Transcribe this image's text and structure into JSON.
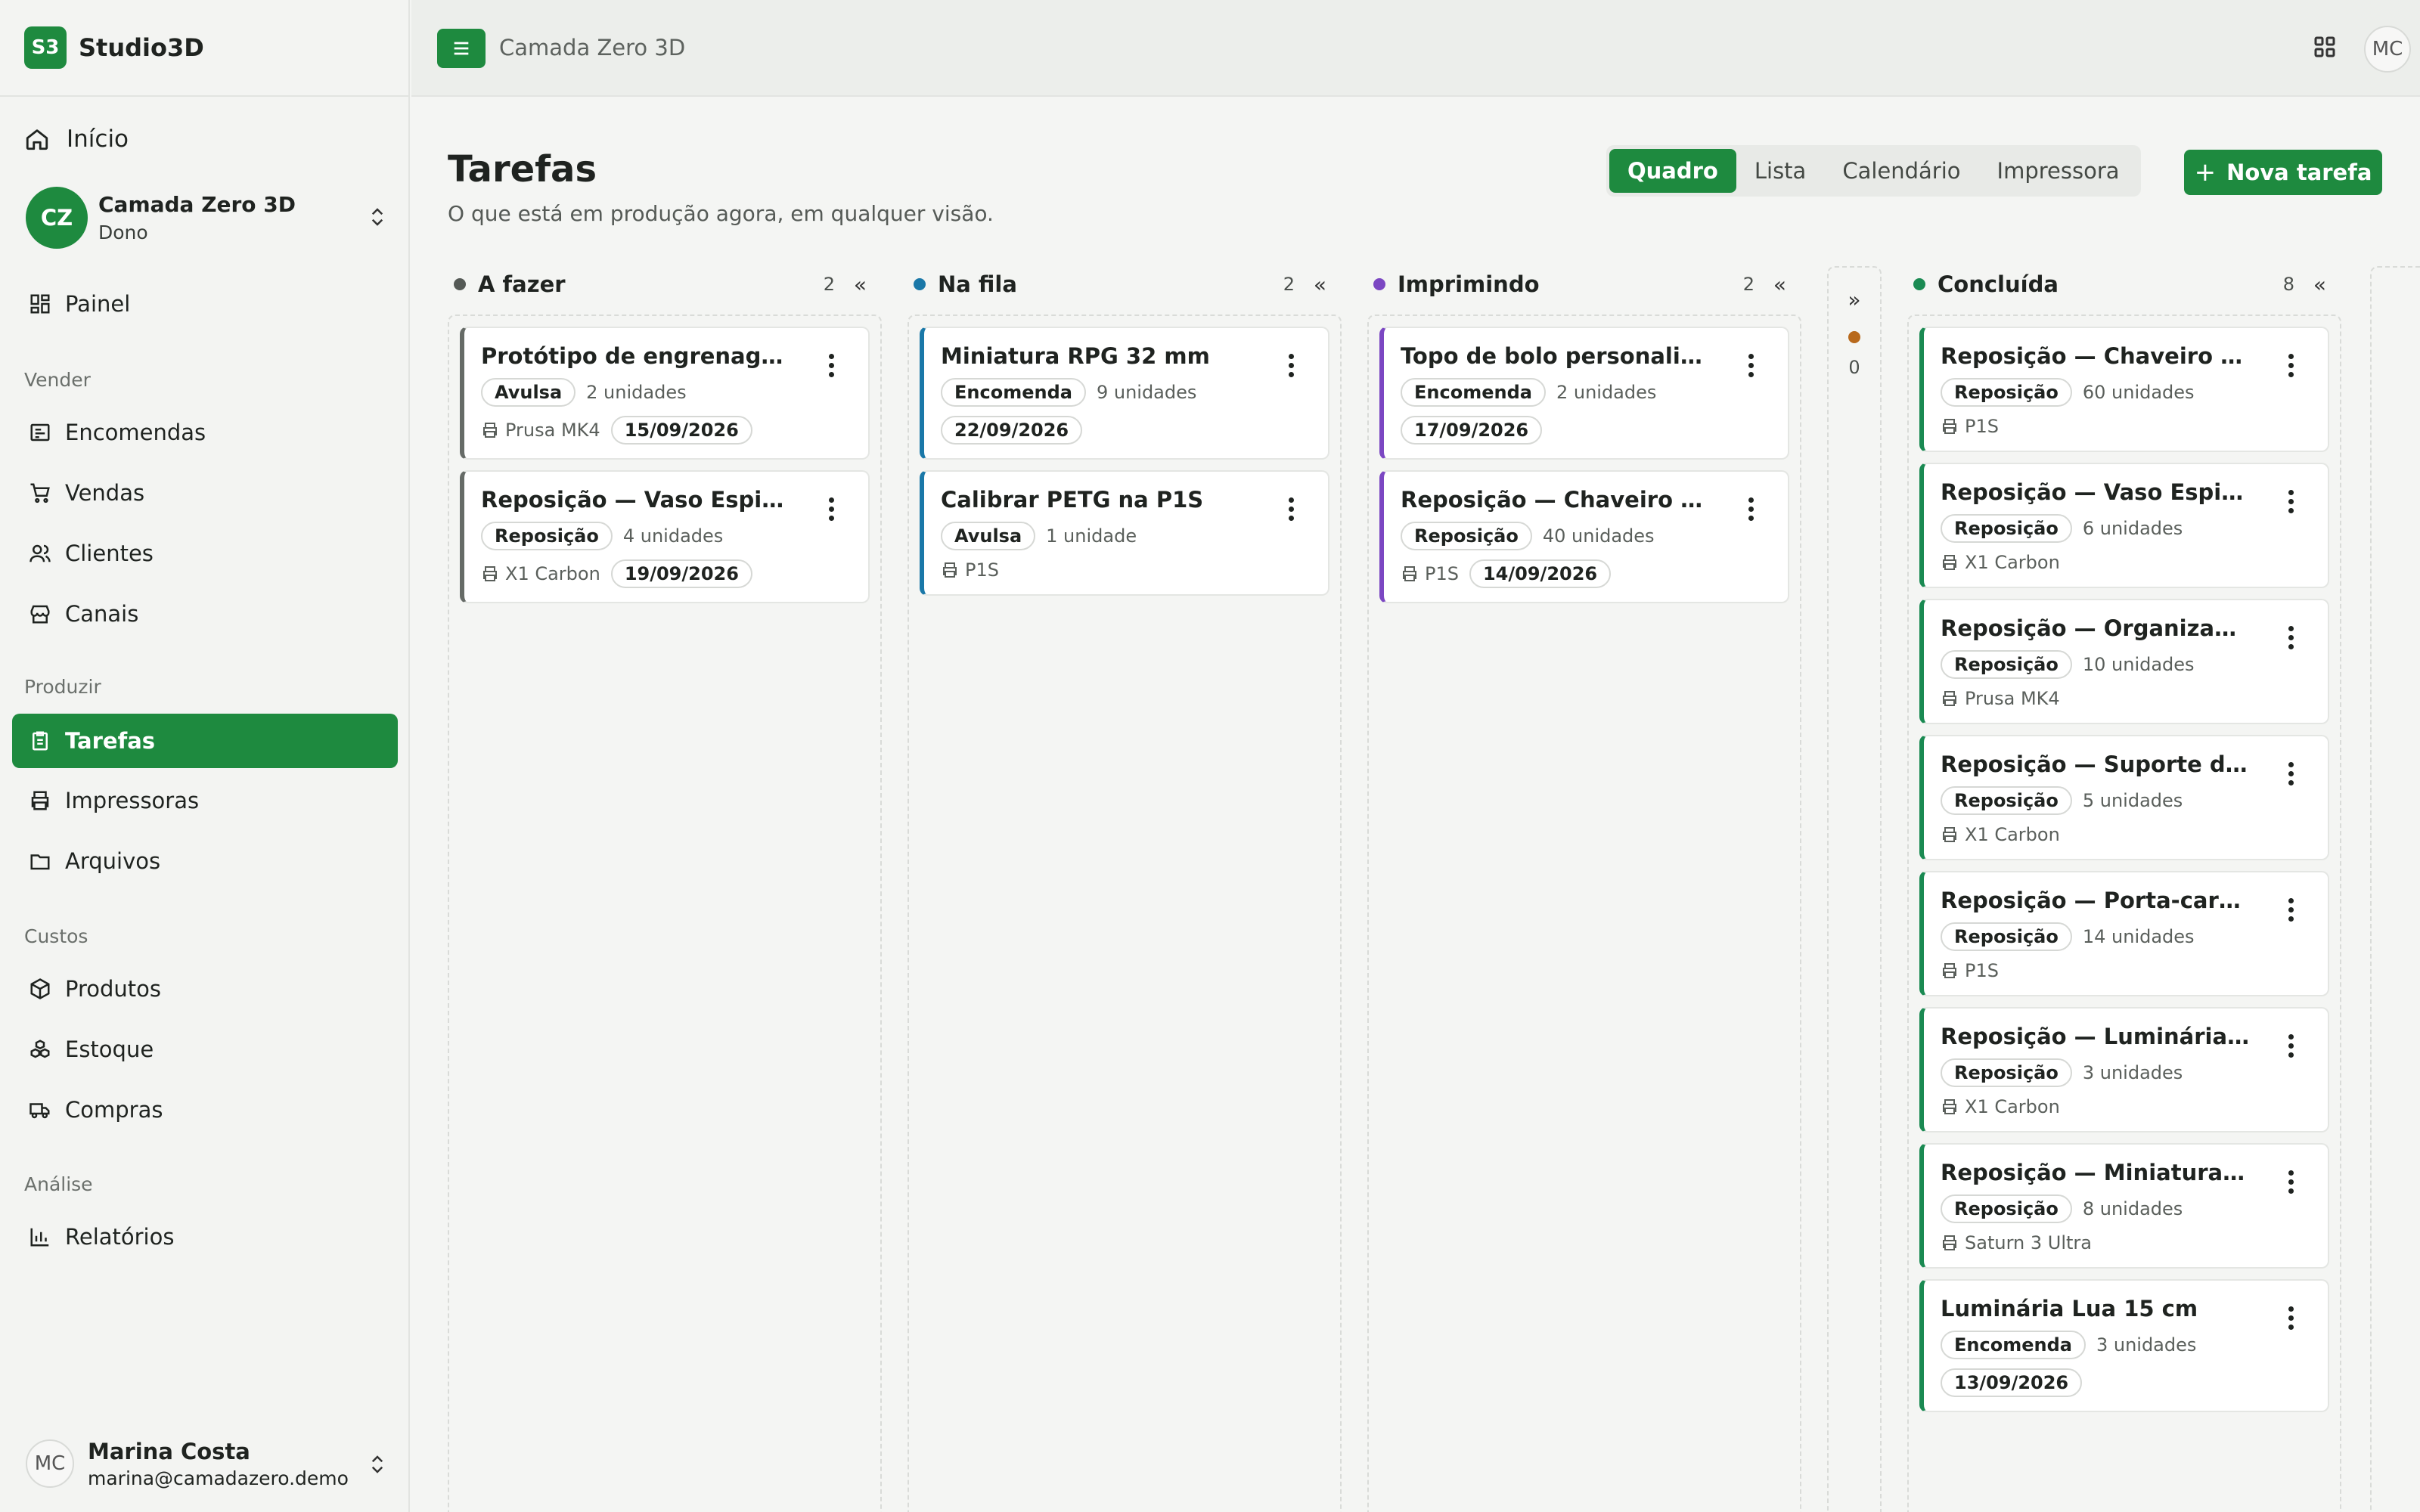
{
  "app": {
    "badge": "S3",
    "name": "Studio3D"
  },
  "sidebar": {
    "home": "Início",
    "org": {
      "initials": "CZ",
      "name": "Camada Zero 3D",
      "role": "Dono"
    },
    "dashboard": "Painel",
    "sections": {
      "sell": "Vender",
      "produce": "Produzir",
      "costs": "Custos",
      "analysis": "Análise"
    },
    "items": {
      "orders": "Encomendas",
      "sales": "Vendas",
      "clients": "Clientes",
      "channels": "Canais",
      "tasks": "Tarefas",
      "printers": "Impressoras",
      "files": "Arquivos",
      "products": "Produtos",
      "stock": "Estoque",
      "purchases": "Compras",
      "reports": "Relatórios"
    },
    "user": {
      "initials": "MC",
      "name": "Marina Costa",
      "email": "marina@camadazero.demo"
    }
  },
  "topbar": {
    "breadcrumb": "Camada Zero 3D",
    "avatar": "MC"
  },
  "page": {
    "title": "Tarefas",
    "subtitle": "O que está em produção agora, em qualquer visão.",
    "views": [
      "Quadro",
      "Lista",
      "Calendário",
      "Impressora"
    ],
    "active_view": "Quadro",
    "new_task": "Nova tarefa"
  },
  "board": {
    "columns": [
      {
        "title": "A fazer",
        "count": "2",
        "color": "#555a56",
        "collapse": "«",
        "cards": [
          {
            "title": "Protótipo de engrenagem …",
            "tag": "Avulsa",
            "units": "2 unidades",
            "printer": "Prusa MK4",
            "date": "15/09/2026",
            "accent": "#666b67"
          },
          {
            "title": "Reposição — Vaso Espiral L…",
            "tag": "Reposição",
            "units": "4 unidades",
            "printer": "X1 Carbon",
            "date": "19/09/2026",
            "accent": "#666b67"
          }
        ]
      },
      {
        "title": "Na fila",
        "count": "2",
        "color": "#1a78a8",
        "collapse": "«",
        "cards": [
          {
            "title": "Miniatura RPG 32 mm",
            "tag": "Encomenda",
            "units": "9 unidades",
            "printer": "",
            "date": "22/09/2026",
            "accent": "#1a78a8"
          },
          {
            "title": "Calibrar PETG na P1S",
            "tag": "Avulsa",
            "units": "1 unidade",
            "printer": "P1S",
            "date": "",
            "accent": "#1a78a8"
          }
        ]
      },
      {
        "title": "Imprimindo",
        "count": "2",
        "color": "#7b47c2",
        "collapse": "«",
        "cards": [
          {
            "title": "Topo de bolo personalizado",
            "tag": "Encomenda",
            "units": "2 unidades",
            "printer": "",
            "date": "17/09/2026",
            "accent": "#7b47c2"
          },
          {
            "title": "Reposição — Chaveiro pers…",
            "tag": "Reposição",
            "units": "40 unidades",
            "printer": "P1S",
            "date": "14/09/2026",
            "accent": "#7b47c2"
          }
        ]
      },
      {
        "title": "Concluída",
        "count": "8",
        "color": "#1a8a52",
        "collapse": "«",
        "cards": [
          {
            "title": "Reposição — Chaveiro pers…",
            "tag": "Reposição",
            "units": "60 unidades",
            "printer": "P1S",
            "date": "",
            "accent": "#1a8a52"
          },
          {
            "title": "Reposição — Vaso Espiral L…",
            "tag": "Reposição",
            "units": "6 unidades",
            "printer": "X1 Carbon",
            "date": "",
            "accent": "#1a8a52"
          },
          {
            "title": "Reposição — Organizador …",
            "tag": "Reposição",
            "units": "10 unidades",
            "printer": "Prusa MK4",
            "date": "",
            "accent": "#1a8a52"
          },
          {
            "title": "Reposição — Suporte de he…",
            "tag": "Reposição",
            "units": "5 unidades",
            "printer": "X1 Carbon",
            "date": "",
            "accent": "#1a8a52"
          },
          {
            "title": "Reposição — Porta-cartões …",
            "tag": "Reposição",
            "units": "14 unidades",
            "printer": "P1S",
            "date": "",
            "accent": "#1a8a52"
          },
          {
            "title": "Reposição — Luminária Lua…",
            "tag": "Reposição",
            "units": "3 unidades",
            "printer": "X1 Carbon",
            "date": "",
            "accent": "#1a8a52"
          },
          {
            "title": "Reposição — Miniatura RPG…",
            "tag": "Reposição",
            "units": "8 unidades",
            "printer": "Saturn 3 Ultra",
            "date": "",
            "accent": "#1a8a52"
          },
          {
            "title": "Luminária Lua 15 cm",
            "tag": "Encomenda",
            "units": "3 unidades",
            "printer": "",
            "date": "13/09/2026",
            "accent": "#1a8a52"
          }
        ]
      }
    ],
    "collapsed": {
      "expand": "»",
      "count": "0",
      "color": "#b8691c"
    }
  },
  "colors": {
    "brand": "#1e8a3f"
  }
}
